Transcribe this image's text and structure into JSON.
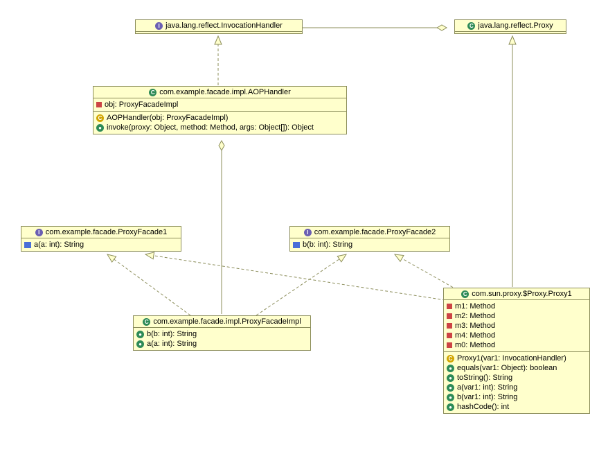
{
  "classes": {
    "invocationHandler": {
      "name": "java.lang.reflect.InvocationHandler",
      "kind": "interface"
    },
    "proxy": {
      "name": "java.lang.reflect.Proxy",
      "kind": "class"
    },
    "aopHandler": {
      "name": "com.example.facade.impl.AOPHandler",
      "kind": "class",
      "fields": [
        {
          "vis": "private",
          "sig": "obj: ProxyFacadeImpl"
        }
      ],
      "methods": [
        {
          "vis": "constructor",
          "sig": "AOPHandler(obj: ProxyFacadeImpl)"
        },
        {
          "vis": "public",
          "sig": "invoke(proxy: Object, method: Method, args: Object[]): Object"
        }
      ]
    },
    "proxyFacade1": {
      "name": "com.example.facade.ProxyFacade1",
      "kind": "interface",
      "methods": [
        {
          "vis": "abstract",
          "sig": "a(a: int): String"
        }
      ]
    },
    "proxyFacade2": {
      "name": "com.example.facade.ProxyFacade2",
      "kind": "interface",
      "methods": [
        {
          "vis": "abstract",
          "sig": "b(b: int): String"
        }
      ]
    },
    "proxyFacadeImpl": {
      "name": "com.example.facade.impl.ProxyFacadeImpl",
      "kind": "class",
      "methods": [
        {
          "vis": "public",
          "sig": "b(b: int): String"
        },
        {
          "vis": "public",
          "sig": "a(a: int): String"
        }
      ]
    },
    "proxy1": {
      "name": "com.sun.proxy.$Proxy.Proxy1",
      "kind": "class",
      "fields": [
        {
          "vis": "private",
          "sig": " m1: Method"
        },
        {
          "vis": "private",
          "sig": " m2: Method"
        },
        {
          "vis": "private",
          "sig": " m3: Method"
        },
        {
          "vis": "private",
          "sig": " m4: Method"
        },
        {
          "vis": "private",
          "sig": " m0: Method"
        }
      ],
      "methods": [
        {
          "vis": "constructor",
          "sig": "Proxy1(var1: InvocationHandler)"
        },
        {
          "vis": "public",
          "sig": "equals(var1: Object): boolean"
        },
        {
          "vis": "public",
          "sig": "toString(): String"
        },
        {
          "vis": "public",
          "sig": "a(var1: int): String"
        },
        {
          "vis": "public",
          "sig": "b(var1: int): String"
        },
        {
          "vis": "public",
          "sig": "hashCode(): int"
        }
      ]
    }
  },
  "relations": [
    {
      "from": "proxy",
      "to": "invocationHandler",
      "type": "aggregation"
    },
    {
      "from": "aopHandler",
      "to": "invocationHandler",
      "type": "realization"
    },
    {
      "from": "aopHandler",
      "to": "proxyFacadeImpl",
      "type": "aggregation"
    },
    {
      "from": "proxyFacadeImpl",
      "to": "proxyFacade1",
      "type": "realization"
    },
    {
      "from": "proxyFacadeImpl",
      "to": "proxyFacade2",
      "type": "realization"
    },
    {
      "from": "proxy1",
      "to": "proxyFacade1",
      "type": "realization"
    },
    {
      "from": "proxy1",
      "to": "proxyFacade2",
      "type": "realization"
    },
    {
      "from": "proxy1",
      "to": "proxy",
      "type": "generalization"
    }
  ],
  "chart_data": {
    "type": "uml-class-diagram",
    "nodes": [
      "java.lang.reflect.InvocationHandler",
      "java.lang.reflect.Proxy",
      "com.example.facade.impl.AOPHandler",
      "com.example.facade.ProxyFacade1",
      "com.example.facade.ProxyFacade2",
      "com.example.facade.impl.ProxyFacadeImpl",
      "com.sun.proxy.$Proxy.Proxy1"
    ],
    "edges": [
      {
        "from": "java.lang.reflect.Proxy",
        "to": "java.lang.reflect.InvocationHandler",
        "type": "aggregation"
      },
      {
        "from": "com.example.facade.impl.AOPHandler",
        "to": "java.lang.reflect.InvocationHandler",
        "type": "realization"
      },
      {
        "from": "com.example.facade.impl.AOPHandler",
        "to": "com.example.facade.impl.ProxyFacadeImpl",
        "type": "aggregation"
      },
      {
        "from": "com.example.facade.impl.ProxyFacadeImpl",
        "to": "com.example.facade.ProxyFacade1",
        "type": "realization"
      },
      {
        "from": "com.example.facade.impl.ProxyFacadeImpl",
        "to": "com.example.facade.ProxyFacade2",
        "type": "realization"
      },
      {
        "from": "com.sun.proxy.$Proxy.Proxy1",
        "to": "com.example.facade.ProxyFacade1",
        "type": "realization"
      },
      {
        "from": "com.sun.proxy.$Proxy.Proxy1",
        "to": "com.example.facade.ProxyFacade2",
        "type": "realization"
      },
      {
        "from": "com.sun.proxy.$Proxy.Proxy1",
        "to": "java.lang.reflect.Proxy",
        "type": "generalization"
      }
    ]
  }
}
